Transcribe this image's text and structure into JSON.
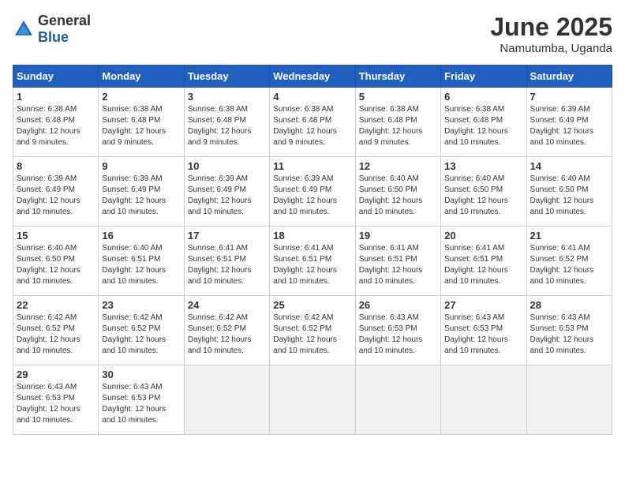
{
  "header": {
    "logo_general": "General",
    "logo_blue": "Blue",
    "month_title": "June 2025",
    "location": "Namutumba, Uganda"
  },
  "days_of_week": [
    "Sunday",
    "Monday",
    "Tuesday",
    "Wednesday",
    "Thursday",
    "Friday",
    "Saturday"
  ],
  "weeks": [
    [
      {
        "day": 1,
        "sunrise": "6:38 AM",
        "sunset": "6:48 PM",
        "daylight": "12 hours and 9 minutes."
      },
      {
        "day": 2,
        "sunrise": "6:38 AM",
        "sunset": "6:48 PM",
        "daylight": "12 hours and 9 minutes."
      },
      {
        "day": 3,
        "sunrise": "6:38 AM",
        "sunset": "6:48 PM",
        "daylight": "12 hours and 9 minutes."
      },
      {
        "day": 4,
        "sunrise": "6:38 AM",
        "sunset": "6:48 PM",
        "daylight": "12 hours and 9 minutes."
      },
      {
        "day": 5,
        "sunrise": "6:38 AM",
        "sunset": "6:48 PM",
        "daylight": "12 hours and 9 minutes."
      },
      {
        "day": 6,
        "sunrise": "6:38 AM",
        "sunset": "6:48 PM",
        "daylight": "12 hours and 10 minutes."
      },
      {
        "day": 7,
        "sunrise": "6:39 AM",
        "sunset": "6:49 PM",
        "daylight": "12 hours and 10 minutes."
      }
    ],
    [
      {
        "day": 8,
        "sunrise": "6:39 AM",
        "sunset": "6:49 PM",
        "daylight": "12 hours and 10 minutes."
      },
      {
        "day": 9,
        "sunrise": "6:39 AM",
        "sunset": "6:49 PM",
        "daylight": "12 hours and 10 minutes."
      },
      {
        "day": 10,
        "sunrise": "6:39 AM",
        "sunset": "6:49 PM",
        "daylight": "12 hours and 10 minutes."
      },
      {
        "day": 11,
        "sunrise": "6:39 AM",
        "sunset": "6:49 PM",
        "daylight": "12 hours and 10 minutes."
      },
      {
        "day": 12,
        "sunrise": "6:40 AM",
        "sunset": "6:50 PM",
        "daylight": "12 hours and 10 minutes."
      },
      {
        "day": 13,
        "sunrise": "6:40 AM",
        "sunset": "6:50 PM",
        "daylight": "12 hours and 10 minutes."
      },
      {
        "day": 14,
        "sunrise": "6:40 AM",
        "sunset": "6:50 PM",
        "daylight": "12 hours and 10 minutes."
      }
    ],
    [
      {
        "day": 15,
        "sunrise": "6:40 AM",
        "sunset": "6:50 PM",
        "daylight": "12 hours and 10 minutes."
      },
      {
        "day": 16,
        "sunrise": "6:40 AM",
        "sunset": "6:51 PM",
        "daylight": "12 hours and 10 minutes."
      },
      {
        "day": 17,
        "sunrise": "6:41 AM",
        "sunset": "6:51 PM",
        "daylight": "12 hours and 10 minutes."
      },
      {
        "day": 18,
        "sunrise": "6:41 AM",
        "sunset": "6:51 PM",
        "daylight": "12 hours and 10 minutes."
      },
      {
        "day": 19,
        "sunrise": "6:41 AM",
        "sunset": "6:51 PM",
        "daylight": "12 hours and 10 minutes."
      },
      {
        "day": 20,
        "sunrise": "6:41 AM",
        "sunset": "6:51 PM",
        "daylight": "12 hours and 10 minutes."
      },
      {
        "day": 21,
        "sunrise": "6:41 AM",
        "sunset": "6:52 PM",
        "daylight": "12 hours and 10 minutes."
      }
    ],
    [
      {
        "day": 22,
        "sunrise": "6:42 AM",
        "sunset": "6:52 PM",
        "daylight": "12 hours and 10 minutes."
      },
      {
        "day": 23,
        "sunrise": "6:42 AM",
        "sunset": "6:52 PM",
        "daylight": "12 hours and 10 minutes."
      },
      {
        "day": 24,
        "sunrise": "6:42 AM",
        "sunset": "6:52 PM",
        "daylight": "12 hours and 10 minutes."
      },
      {
        "day": 25,
        "sunrise": "6:42 AM",
        "sunset": "6:52 PM",
        "daylight": "12 hours and 10 minutes."
      },
      {
        "day": 26,
        "sunrise": "6:43 AM",
        "sunset": "6:53 PM",
        "daylight": "12 hours and 10 minutes."
      },
      {
        "day": 27,
        "sunrise": "6:43 AM",
        "sunset": "6:53 PM",
        "daylight": "12 hours and 10 minutes."
      },
      {
        "day": 28,
        "sunrise": "6:43 AM",
        "sunset": "6:53 PM",
        "daylight": "12 hours and 10 minutes."
      }
    ],
    [
      {
        "day": 29,
        "sunrise": "6:43 AM",
        "sunset": "6:53 PM",
        "daylight": "12 hours and 10 minutes."
      },
      {
        "day": 30,
        "sunrise": "6:43 AM",
        "sunset": "6:53 PM",
        "daylight": "12 hours and 10 minutes."
      },
      null,
      null,
      null,
      null,
      null
    ]
  ]
}
